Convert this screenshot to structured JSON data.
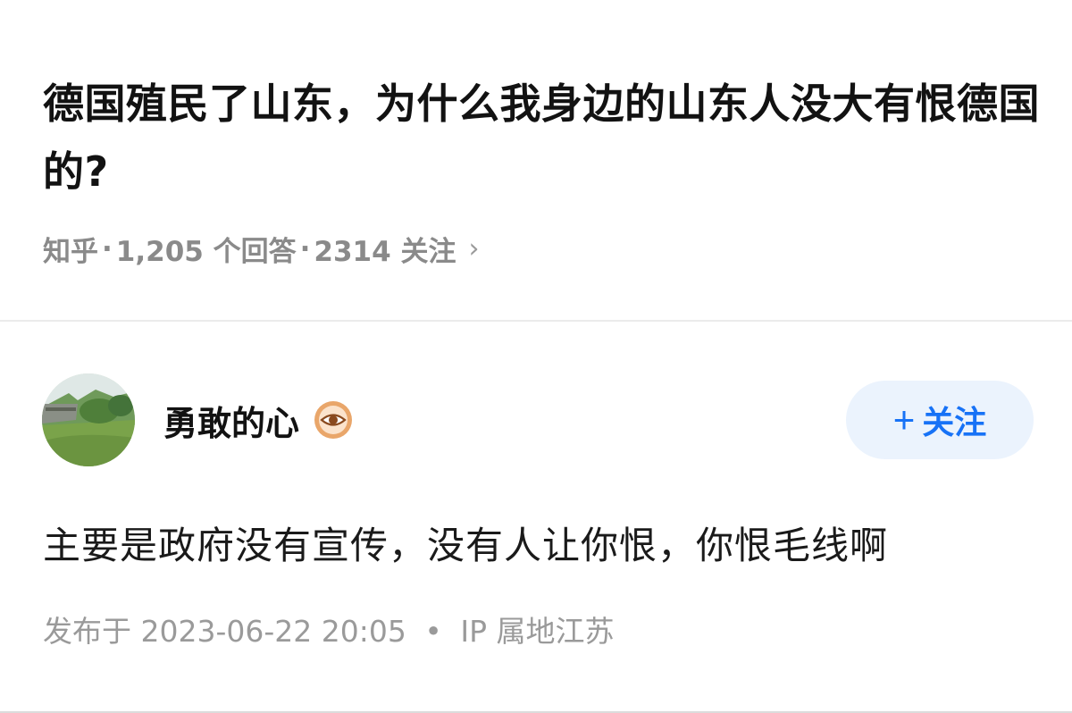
{
  "question": {
    "title": "德国殖民了山东，为什么我身边的山东人没大有恨德国的?",
    "source": "知乎",
    "answers": "1,205 个回答",
    "followers": "2314 关注",
    "chevron": "›"
  },
  "author": {
    "name": "勇敢的心",
    "badge_icon": "eye-badge-icon",
    "follow_plus": "+",
    "follow_label": "关注"
  },
  "answer": {
    "text": "主要是政府没有宣传，没有人让你恨，你恨毛线啊",
    "published": "发布于 2023-06-22 20:05",
    "ip": "IP 属地江苏"
  },
  "colors": {
    "accent": "#1772f6",
    "follow_bg": "#ebf3fd",
    "meta_gray": "#8a8a8a",
    "badge_ring": "#c8733a"
  }
}
